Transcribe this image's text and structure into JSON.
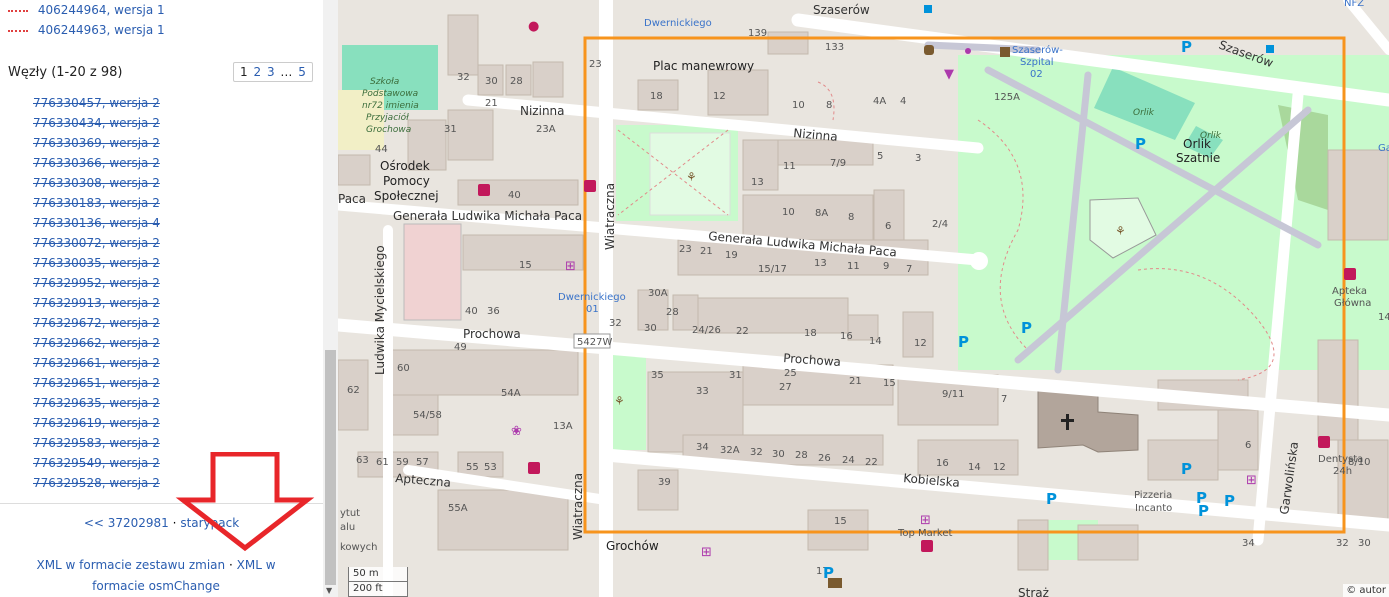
{
  "ways": [
    {
      "label": "406244964, wersja 1"
    },
    {
      "label": "406244963, wersja 1"
    }
  ],
  "nodes": {
    "title": "Węzły (1-20 z 98)",
    "pagination": {
      "current": "1",
      "pages": [
        "2",
        "3"
      ],
      "ellipsis": "…",
      "last": "5"
    },
    "items": [
      "776330457, wersja 2",
      "776330434, wersja 2",
      "776330369, wersja 2",
      "776330366, wersja 2",
      "776330308, wersja 2",
      "776330183, wersja 2",
      "776330136, wersja 4",
      "776330072, wersja 2",
      "776330035, wersja 2",
      "776329952, wersja 2",
      "776329913, wersja 2",
      "776329672, wersja 2",
      "776329662, wersja 2",
      "776329661, wersja 2",
      "776329651, wersja 2",
      "776329635, wersja 2",
      "776329619, wersja 2",
      "776329583, wersja 2",
      "776329549, wersja 2",
      "776329528, wersja 2"
    ]
  },
  "history_nav": {
    "prev": "<< 37202981",
    "sep": "·",
    "next": "starypack"
  },
  "downloads": {
    "changeset_xml": "XML w formacie zestawu zmian",
    "sep": "·",
    "osmchange_xml": "XML w formacie osmChange"
  },
  "map": {
    "streets": {
      "szaserow": "Szaserów",
      "nizinna": "Nizinna",
      "paca": "Generała Ludwika Michała Paca",
      "paca_short": "Paca",
      "prochowa": "Prochowa",
      "wiatraczna": "Wiatraczna",
      "mycielskiego": "Ludwika Mycielskiego",
      "kobielska": "Kobielska",
      "apteczna": "Apteczna",
      "grochow": "Grochów",
      "garwolinska": "Garwolińska",
      "straz": "Straż"
    },
    "labels": {
      "plac": "Plac manewrowy",
      "osrodek_1": "Ośrodek",
      "osrodek_2": "Pomocy",
      "osrodek_3": "Społecznej",
      "szkola_1": "Szkoła",
      "szkola_2": "Podstawowa",
      "szkola_3": "nr72 imienia",
      "szkola_4": "Przyjaciół",
      "szkola_5": "Grochowa",
      "dwernickiego_top": "Dwernickiego",
      "dwernickiego_bus_1": "Dwernickiego",
      "dwernickiego_bus_2": "01",
      "szaserow_szpital_1": "Szaserów-",
      "szaserow_szpital_2": "Szpital",
      "szaserow_szpital_3": "02",
      "orlik_1": "Orlik",
      "orlik_2": "Orlik",
      "orlik_szatnie_1": "Orlik",
      "orlik_szatnie_2": "Szatnie",
      "apteka_1": "Apteka",
      "apteka_2": "Główna",
      "dentysta_1": "Dentysta",
      "dentysta_2": "24h",
      "pizzeria_1": "Pizzeria",
      "pizzeria_2": "Incanto",
      "route_ref": "5427W",
      "top_market": "Top Market",
      "instytut_1": "ytut",
      "instytut_2": "alu",
      "instytut_3": "kowych",
      "nfz": "NFZ",
      "gar": "Ga"
    },
    "house_numbers": {
      "n1": "23",
      "n2": "139",
      "n3": "133",
      "n4": "32",
      "n5": "30",
      "n6": "28",
      "n7": "18",
      "n8": "12",
      "n9": "10",
      "n10": "8",
      "n11": "4A",
      "n12": "4",
      "n13": "21",
      "n14": "23A",
      "n15": "31",
      "n16": "44",
      "n17": "40",
      "n18": "11",
      "n19": "7/9",
      "n20": "5",
      "n21": "3",
      "n22": "13",
      "n23": "10",
      "n24": "8A",
      "n25": "8",
      "n26": "6",
      "n27": "2/4",
      "n28": "125A",
      "n29": "23",
      "n30": "21",
      "n31": "19",
      "n32": "15/17",
      "n33": "13",
      "n34": "11",
      "n35": "9",
      "n36": "7",
      "n37": "15",
      "n38": "30A",
      "n39": "32",
      "n40": "30",
      "n41": "28",
      "n42": "24/26",
      "n43": "22",
      "n44": "18",
      "n45": "16",
      "n46": "14",
      "n47": "12",
      "n48": "40",
      "n49": "36",
      "n50": "49",
      "n51": "35",
      "n52": "33",
      "n53": "31",
      "n54": "27",
      "n55": "25",
      "n56": "21",
      "n57": "15",
      "n58": "9/11",
      "n59": "7",
      "n60": "60",
      "n61": "54A",
      "n62": "62",
      "n63": "54/58",
      "n64": "13A",
      "n65": "34",
      "n66": "32A",
      "n67": "32",
      "n68": "30",
      "n69": "28",
      "n70": "26",
      "n71": "24",
      "n72": "22",
      "n73": "16",
      "n74": "14",
      "n75": "12",
      "n76": "63",
      "n77": "61",
      "n78": "59",
      "n79": "57",
      "n80": "55",
      "n81": "53",
      "n82": "39",
      "n83": "55A",
      "n84": "15",
      "n85": "17",
      "n86": "6",
      "n87": "8/10",
      "n88": "14",
      "n89": "32",
      "n90": "30",
      "n91": "34"
    },
    "scale": {
      "metric": "50 m",
      "imperial": "200 ft"
    },
    "attribution": "© autor",
    "colors": {
      "background": "#e9e5df",
      "building": "#d9d0c9",
      "road": "#ffffff",
      "park": "#c8facc",
      "pitch": "#88e0be",
      "selection": "#f7941d",
      "arrow": "#e8262a",
      "church": "#b2a59b"
    }
  }
}
